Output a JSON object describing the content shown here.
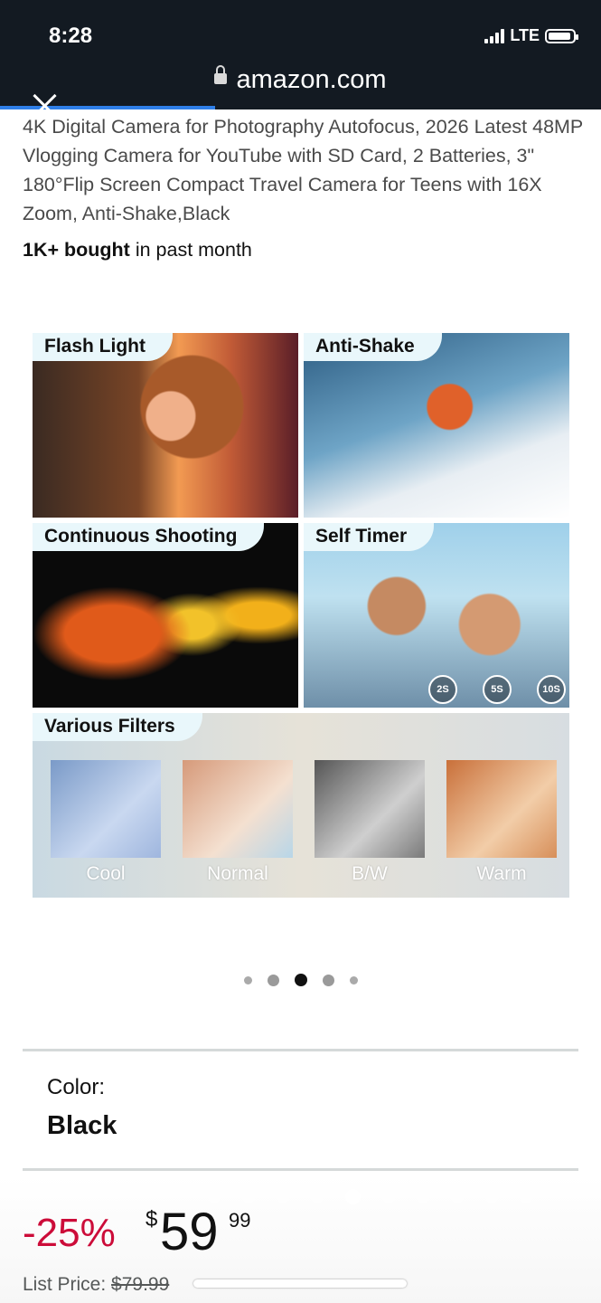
{
  "status_bar": {
    "time": "8:28",
    "network": "LTE"
  },
  "browser": {
    "url": "amazon.com"
  },
  "product": {
    "title": "4K Digital Camera for Photography Autofocus, 2026 Latest 48MP Vlogging Camera for YouTube with SD Card, 2 Batteries, 3\" 180°Flip Screen Compact Travel Camera for Teens with 16X Zoom, Anti-Shake,Black",
    "bought_bold": "1K+ bought",
    "bought_rest": " in past month"
  },
  "gallery": {
    "tiles": [
      {
        "label": "Flash Light"
      },
      {
        "label": "Anti-Shake"
      },
      {
        "label": "Continuous Shooting"
      },
      {
        "label": "Self Timer"
      },
      {
        "label": "Various Filters"
      }
    ],
    "timers": [
      "2S",
      "5S",
      "10S"
    ],
    "filters": [
      "Cool",
      "Normal",
      "B/W",
      "Warm"
    ],
    "carousel_dots": 5,
    "active_dot": 3
  },
  "variation": {
    "label": "Color:",
    "value": "Black"
  },
  "pricing": {
    "discount": "-25%",
    "currency": "$",
    "whole": "59",
    "cents": "99",
    "list_label": "List Price: ",
    "list_value": "$79.99"
  }
}
